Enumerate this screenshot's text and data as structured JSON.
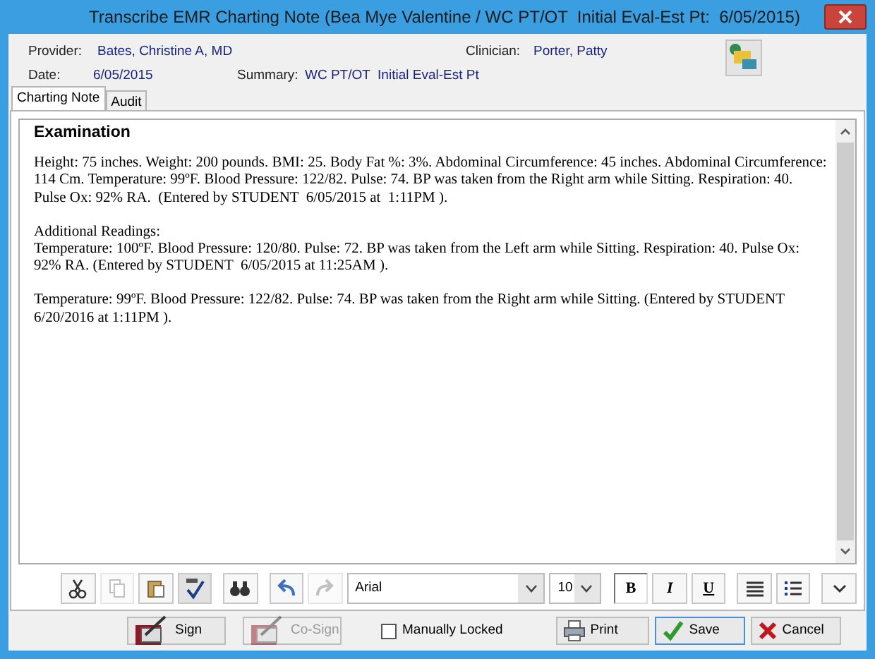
{
  "window": {
    "title": "Transcribe EMR Charting Note (Bea Mye Valentine / WC PT/OT  Initial Eval-Est Pt:  6/05/2015)"
  },
  "header": {
    "fields": [
      {
        "label": "Provider:",
        "value": "Bates, Christine A, MD"
      },
      {
        "label": "Clinician:",
        "value": "Porter, Patty"
      },
      {
        "label": "Date:",
        "value": "6/05/2015"
      },
      {
        "label": "Summary:",
        "value": "WC PT/OT  Initial Eval-Est Pt"
      }
    ]
  },
  "tabs": [
    {
      "label": "Charting Note",
      "selected": true
    },
    {
      "label": "Audit",
      "selected": false
    }
  ],
  "note": {
    "heading": "Examination",
    "paragraphs": [
      "Height: 75 inches. Weight: 200 pounds. BMI: 25. Body Fat %: 3%. Abdominal Circumference: 45 inches. Abdominal Circumference: 114 Cm. Temperature: 99ºF. Blood Pressure: 122/82. Pulse: 74. BP was taken from the Right arm while Sitting. Respiration: 40. Pulse Ox: 92% RA.  (Entered by STUDENT  6/05/2015 at  1:11PM ).",
      "Additional Readings:\nTemperature: 100ºF. Blood Pressure: 120/80. Pulse: 72. BP was taken from the Left arm while Sitting. Respiration: 40. Pulse Ox: 92% RA. (Entered by STUDENT  6/05/2015 at 11:25AM ).",
      "Temperature: 99ºF. Blood Pressure: 122/82. Pulse: 74. BP was taken from the Right arm while Sitting. (Entered by STUDENT  6/20/2016 at 1:11PM )."
    ]
  },
  "toolbar": [
    {
      "kind": "cut",
      "disabled": false
    },
    {
      "kind": "copy",
      "disabled": true
    },
    {
      "kind": "paste",
      "disabled": false
    },
    {
      "kind": "spell",
      "disabled": false
    },
    {
      "kind": "find",
      "disabled": false
    },
    {
      "kind": "undo",
      "disabled": false
    },
    {
      "kind": "redo",
      "disabled": true
    },
    {
      "kind": "font",
      "value": "Arial"
    },
    {
      "kind": "size",
      "value": "10"
    },
    {
      "kind": "bold",
      "label": "B",
      "pressed": true
    },
    {
      "kind": "italic",
      "label": "I",
      "pressed": false
    },
    {
      "kind": "underline",
      "label": "U",
      "pressed": false
    },
    {
      "kind": "align",
      "disabled": false
    },
    {
      "kind": "list",
      "disabled": false
    },
    {
      "kind": "more",
      "disabled": false
    }
  ],
  "footer": [
    {
      "kind": "sign",
      "label": "Sign",
      "disabled": false
    },
    {
      "kind": "sign",
      "label": "Co-Sign",
      "disabled": true
    },
    {
      "kind": "checkbox",
      "label": "Manually Locked",
      "checked": false
    },
    {
      "kind": "print",
      "label": "Print",
      "disabled": false
    },
    {
      "kind": "save",
      "label": "Save",
      "disabled": false
    },
    {
      "kind": "cancel",
      "label": "Cancel",
      "disabled": false
    }
  ]
}
